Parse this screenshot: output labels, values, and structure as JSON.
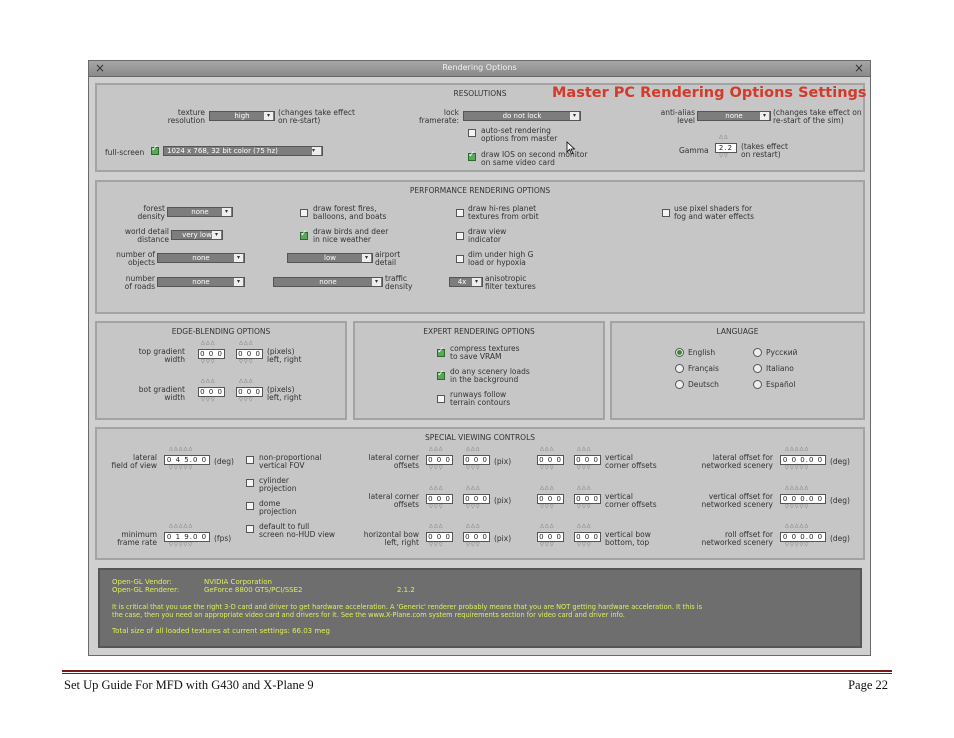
{
  "window": {
    "title": "Rendering Options",
    "close_left": "×",
    "close_right": "×"
  },
  "headline": "Master PC Rendering Options Settings",
  "resolutions": {
    "header": "RESOLUTIONS",
    "texture_label1": "texture",
    "texture_label2": "resolution",
    "texture_value": "high",
    "texture_note1": "(changes take effect",
    "texture_note2": "on re-start)",
    "lock_label1": "lock",
    "lock_label2": "framerate:",
    "lock_value": "do not lock",
    "antialias_label1": "anti-alias",
    "antialias_label2": "level",
    "antialias_value": "none",
    "antialias_note1": "(changes take effect on",
    "antialias_note2": "re-start of the sim)",
    "fullscreen_label": "full-screen",
    "fullscreen_value": "1024 x 768, 32 bit color (75 hz)",
    "autoset1": "auto-set rendering",
    "autoset2": "options from master",
    "drawios1": "draw IOS on second monitor",
    "drawios2": "on same video card",
    "gamma_label": "Gamma",
    "gamma_value": "2.2",
    "gamma_note1": "(takes effect",
    "gamma_note2": "on restart)"
  },
  "performance": {
    "header": "PERFORMANCE RENDERING OPTIONS",
    "forest1": "forest",
    "forest2": "density",
    "forest_value": "none",
    "world1": "world detail",
    "world2": "distance",
    "world_value": "very low",
    "objects1": "number of",
    "objects2": "objects",
    "objects_value": "none",
    "roads1": "number",
    "roads2": "of roads",
    "roads_value": "none",
    "fires1": "draw forest fires,",
    "fires2": "balloons, and boats",
    "birds1": "draw birds and deer",
    "birds2": "in nice weather",
    "airport_value": "low",
    "airport1": "airport",
    "airport2": "detail",
    "traffic_value": "none",
    "traffic1": "traffic",
    "traffic2": "density",
    "hires1": "draw hi-res planet",
    "hires2": "textures from orbit",
    "view1": "draw view",
    "view2": "indicator",
    "dim1": "dim under high G",
    "dim2": "load or hypoxia",
    "aniso_value": "4x",
    "aniso1": "anisotropic",
    "aniso2": "filter textures",
    "shaders1": "use pixel shaders for",
    "shaders2": "fog and water effects"
  },
  "edge": {
    "header": "EDGE-BLENDING OPTIONS",
    "top1": "top gradient",
    "top2": "width",
    "top_left": "0 0 0",
    "top_right": "0 0 0",
    "top_note1": "(pixels)",
    "top_note2": "left, right",
    "bot1": "bot gradient",
    "bot2": "width",
    "bot_left": "0 0 0",
    "bot_right": "0 0 0",
    "bot_note1": "(pixels)",
    "bot_note2": "left, right"
  },
  "expert": {
    "header": "EXPERT RENDERING OPTIONS",
    "compress1": "compress textures",
    "compress2": "to save VRAM",
    "scenery1": "do any scenery loads",
    "scenery2": "in the background",
    "runways1": "runways follow",
    "runways2": "terrain contours"
  },
  "language": {
    "header": "LANGUAGE",
    "english": "English",
    "russian": "Русский",
    "french": "Français",
    "italian": "Italiano",
    "german": "Deutsch",
    "spanish": "Español"
  },
  "special": {
    "header": "SPECIAL VIEWING CONTROLS",
    "fov1": "lateral",
    "fov2": "field of view",
    "fov_value": "0 4 5.0 0",
    "fov_unit": "(deg)",
    "nonprop1": "non-proportional",
    "nonprop2": "vertical FOV",
    "cyl1": "cylinder",
    "cyl2": "projection",
    "dome1": "dome",
    "dome2": "projection",
    "default1": "default to full",
    "default2": "screen no-HUD view",
    "minfr1": "minimum",
    "minfr2": "frame rate",
    "minfr_value": "0 1 9.0 0",
    "minfr_unit": "(fps)",
    "lco_a1": "lateral corner",
    "lco_a2": "offsets",
    "lco_b1": "lateral corner",
    "lco_b2": "offsets",
    "hbow1": "horizontal bow",
    "hbow2": "left, right",
    "pix": "(pix)",
    "zero": "0 0 0",
    "vco_a1": "vertical",
    "vco_a2": "corner offsets",
    "vco_b1": "vertical",
    "vco_b2": "corner offsets",
    "vbow1": "vertical bow",
    "vbow2": "bottom, top",
    "lon1": "lateral offset for",
    "lon2": "networked scenery",
    "von1": "vertical offset for",
    "von2": "networked scenery",
    "ron1": "roll offset for",
    "ron2": "networked scenery",
    "net_value": "0 0 0.0 0",
    "deg": "(deg)"
  },
  "opengl": {
    "vendor_label": "Open-GL Vendor:",
    "vendor_value": "NVIDIA Corporation",
    "renderer_label": "Open-GL Renderer:",
    "renderer_value": "GeForce 8800 GTS/PCI/SSE2",
    "version": "2.1.2",
    "note1": "It is critical that you use the right 3-D card and driver to get hardware acceleration. A 'Generic' renderer probably means that you are NOT getting hardware acceleration. It this is",
    "note2": "the case, then you need an appropriate video card and drivers for it. See the www.X-Plane.com system requirements section for video card and driver info.",
    "total": "Total size of all loaded textures at current settings: 66.03 meg"
  },
  "footer": {
    "left": "Set Up Guide For MFD with G430 and X-Plane 9",
    "right": "Page 22"
  },
  "colors": {
    "headline": "#d43a2a",
    "footer_rule": "#7a1a1a",
    "info_text": "#e0ef5a"
  }
}
